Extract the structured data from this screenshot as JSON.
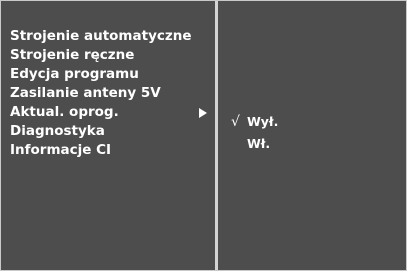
{
  "menu": {
    "items": [
      {
        "label": "Strojenie automatyczne"
      },
      {
        "label": "Strojenie ręczne"
      },
      {
        "label": "Edycja programu"
      },
      {
        "label": "Zasilanie anteny 5V"
      },
      {
        "label": "Aktual. oprog."
      },
      {
        "label": "Diagnostyka"
      },
      {
        "label": "Informacje CI"
      }
    ],
    "selected_index": 4,
    "submenu_arrow": "right-triangle-icon"
  },
  "submenu": {
    "options": [
      {
        "label": "Wył.",
        "checked": true
      },
      {
        "label": "Wł.",
        "checked": false
      }
    ],
    "check_glyph": "√"
  },
  "colors": {
    "background": "#4d4d4d",
    "text": "#ffffff",
    "divider": "#d4d4d4"
  }
}
